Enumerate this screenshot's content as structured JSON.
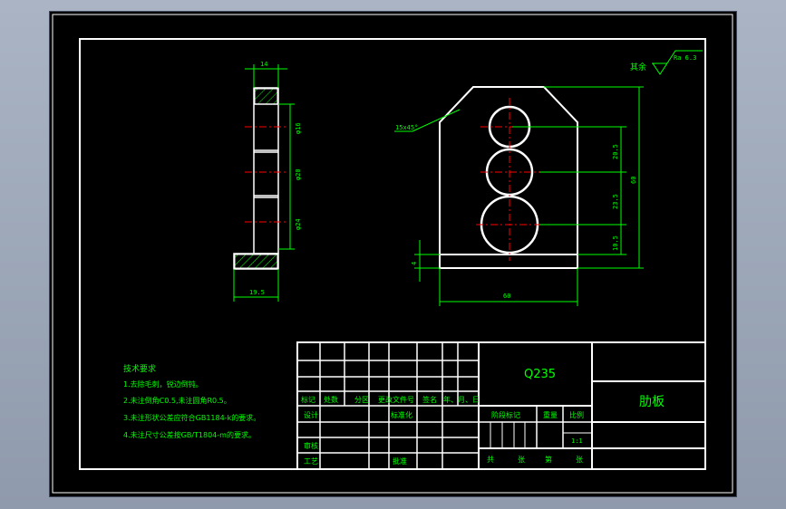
{
  "colors": {
    "background": "#000000",
    "frame": "#ffffff",
    "dimension": "#00ff00",
    "centerline": "#ff0000",
    "hatch": "#00ff00"
  },
  "drawing": {
    "side_view": {
      "dim_top": "14",
      "dim_bottom": "19.5",
      "dim_phi16": "φ16",
      "dim_phi20": "φ20",
      "dim_phi24": "φ24"
    },
    "front_view": {
      "chamfer": "15x45°",
      "dim_width": "60",
      "dim_height": "60",
      "dim_a": "20.5",
      "dim_b": "23.5",
      "dim_c": "10.5",
      "dim_base": "4"
    },
    "roughness": {
      "prefix": "其余",
      "value": "Ra 6.3"
    }
  },
  "tech_requirements": {
    "title": "技术要求",
    "items": [
      "1.去除毛刺，锐边倒钝。",
      "2.未注倒角C0.5,未注圆角R0.5。",
      "3.未注形状公差应符合GB1184-k的要求。",
      "4.未注尺寸公差按GB/T1804-m的要求。"
    ]
  },
  "title_block": {
    "material": "Q235",
    "part_name": "肋板",
    "headers": [
      "标记",
      "处数",
      "分区",
      "更改文件号",
      "签名",
      "年、月、日"
    ],
    "design": "设计",
    "standardize": "标准化",
    "review": "审核",
    "process": "工艺",
    "approve": "批准",
    "stage_mark": "阶段标记",
    "weight": "重量",
    "scale_label": "比例",
    "scale_value": "1:1",
    "sheet_total": "共",
    "sheet_unit": "张",
    "sheet_index": "第",
    "sheet_unit2": "张"
  }
}
